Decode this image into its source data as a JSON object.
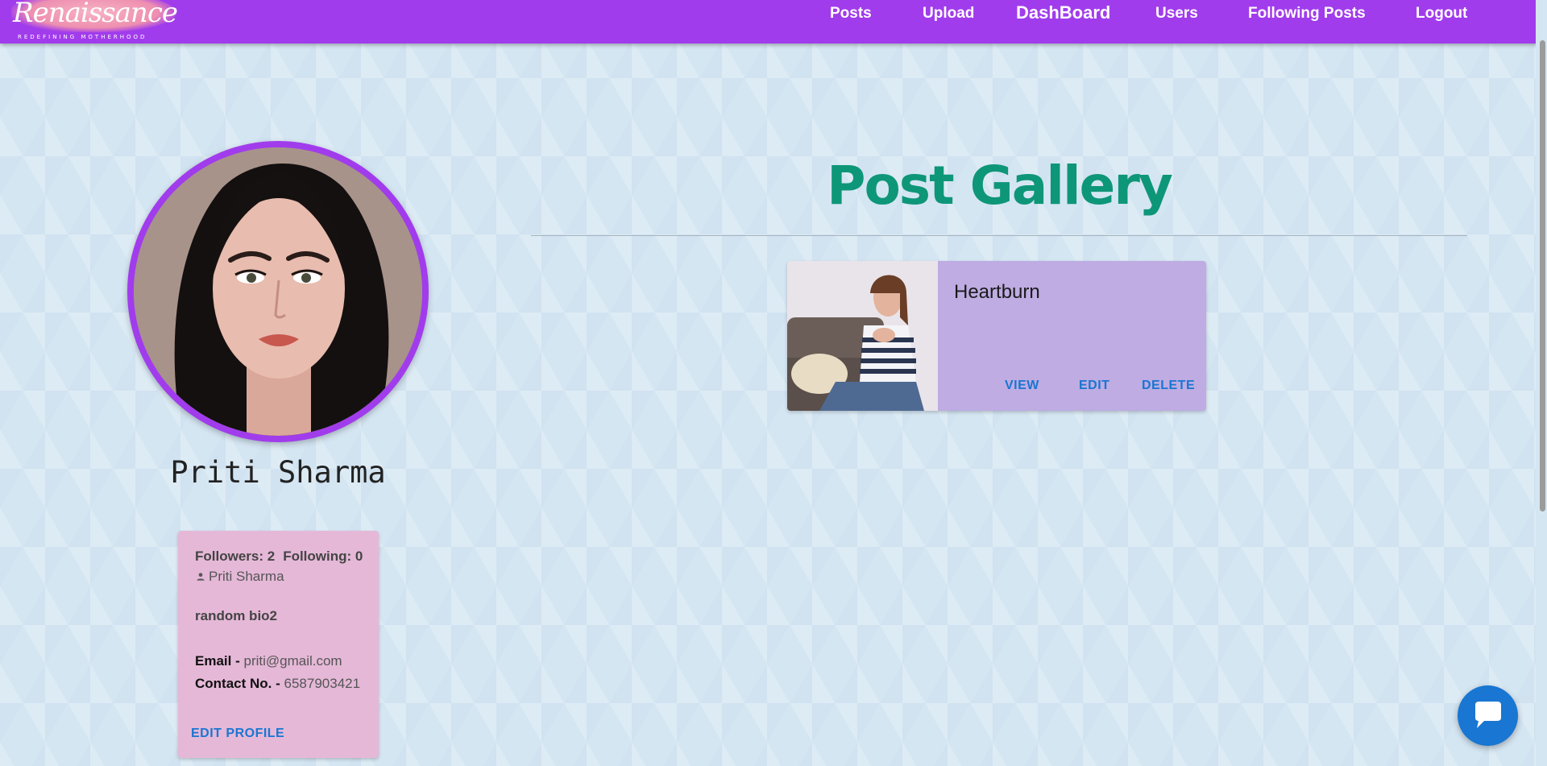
{
  "nav": {
    "logo_text": "Renaissance",
    "logo_tagline": "REDEFINING MOTHERHOOD",
    "links": [
      "Posts",
      "Upload",
      "DashBoard",
      "Users",
      "Following Posts",
      "Logout"
    ]
  },
  "profile": {
    "name": "Priti Sharma",
    "followers_label": "Followers: 2",
    "following_label": "Following: 0",
    "username": "Priti Sharma",
    "bio": "random bio2",
    "email_label": "Email -",
    "email": "priti@gmail.com",
    "contact_label": "Contact No. -",
    "contact": "6587903421",
    "edit_button": "EDIT PROFILE"
  },
  "gallery": {
    "title": "Post Gallery",
    "posts": [
      {
        "title": "Heartburn",
        "actions": [
          "VIEW",
          "EDIT",
          "DELETE"
        ]
      }
    ]
  },
  "colors": {
    "navbar": "#a13cec",
    "accent_blue": "#1976d2",
    "gallery_title": "#0e9678",
    "info_card": "#e5b8d7",
    "post_card": "#beace2"
  },
  "icons": [
    "person-icon",
    "chat-icon"
  ]
}
